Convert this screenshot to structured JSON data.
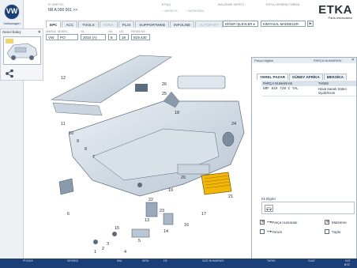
{
  "brand": {
    "logo": "VW",
    "name": "Volkswagen"
  },
  "header": {
    "fi_label": "FI ÜRETİCİ",
    "fi_value": "6R A 000 001 >>",
    "etk_label": "ETK(i)",
    "radio_1": "NEREYE",
    "radio_2": "NEREDEN",
    "basket_label": "MALZEME SEPETİ",
    "list_label": "TOPLU SİPARİŞ FORMU",
    "etka": "ETKA",
    "etka_sub": "Parts Information"
  },
  "tabs": [
    {
      "label": "EPC",
      "active": true
    },
    {
      "label": "ACC",
      "active": false
    },
    {
      "label": "TOOLS",
      "active": false
    },
    {
      "label": "NOBA",
      "disabled": true
    },
    {
      "label": "PL24",
      "active": false
    },
    {
      "label": "SUPPORTWEB",
      "active": false
    },
    {
      "label": "INFOLINE",
      "active": false
    },
    {
      "label": "AUTOPART",
      "disabled": true
    }
  ],
  "functions": {
    "other": "DİĞER İŞLEVLER ▾",
    "selected": "KİMYASAL MADDELER",
    "button": "▸"
  },
  "filters": [
    {
      "label": "MARKA",
      "value": "VW"
    },
    {
      "label": "MODEL",
      "value": "PO"
    },
    {
      "label": "YIL",
      "value": "2010 (A)"
    },
    {
      "label": "HG",
      "value": "8"
    },
    {
      "label": "UG",
      "value": "19"
    },
    {
      "label": "RESİM NO.",
      "value": "819.430"
    }
  ],
  "general_view": {
    "title": "Genel bakış",
    "close": "✕"
  },
  "diagram": {
    "callouts": [
      "26",
      "25",
      "18",
      "24",
      "21",
      "20",
      "19",
      "22",
      "23",
      "12",
      "11",
      "10",
      "9",
      "8",
      "7",
      "6",
      "5",
      "4",
      "3",
      "2",
      "1",
      "13",
      "14",
      "15",
      "16",
      "17"
    ]
  },
  "part_panel": {
    "title": "Parça bilgileri",
    "part_number_label": "PARÇA NUMARASI",
    "close": "✕",
    "tabs": [
      "YEREL PAZAR",
      "GÜNEY AFRİKA",
      "MEKSİKA"
    ],
    "columns": [
      "PARÇA NUMARASI",
      "TANIM"
    ],
    "rows": [
      {
        "number": "6RF 819 728 C  YAL",
        "desc": "Hava kanalı Saten siyah/krom"
      }
    ],
    "ek_label": "Ek bilgiler",
    "options": {
      "part_number": "Parça numarası",
      "material": "Malzeme",
      "comment": "Yorum",
      "list": "Tüplo"
    }
  },
  "footer": {
    "items": [
      {
        "label": "PİYASA",
        "value": ""
      },
      {
        "label": "SİPARİŞ",
        "value": ""
      },
      {
        "label": "İMA",
        "value": ""
      },
      {
        "label": "SIRA",
        "value": ""
      },
      {
        "label": "DE",
        "value": ""
      },
      {
        "label": "SAĞ NUMARASI",
        "value": ""
      },
      {
        "label": "TARİH",
        "value": ""
      },
      {
        "label": "SAAT",
        "value": ""
      },
      {
        "label": "KAT",
        "value": "672"
      }
    ]
  },
  "colors": {
    "accent": "#1c3f78",
    "highlight": "#f2b705"
  }
}
